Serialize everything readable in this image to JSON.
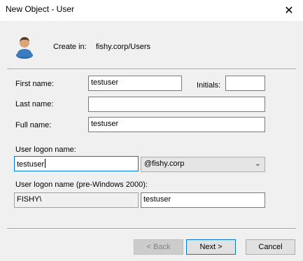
{
  "window": {
    "title": "New Object - User",
    "close_glyph": "✕"
  },
  "header": {
    "create_in_label": "Create in:",
    "create_in_value": "fishy.corp/Users",
    "icon": "user-icon"
  },
  "form": {
    "first_name_label": "First name:",
    "first_name_value": "testuser",
    "initials_label": "Initials:",
    "initials_value": "",
    "last_name_label": "Last name:",
    "last_name_value": "",
    "full_name_label": "Full name:",
    "full_name_value": "testuser",
    "logon_label": "User logon name:",
    "logon_value": "testuser",
    "domain_value": "@fishy.corp",
    "pre2000_label": "User logon name (pre-Windows 2000):",
    "pre2000_domain": "FISHY\\",
    "pre2000_value": "testuser"
  },
  "buttons": {
    "back": "< Back",
    "next": "Next >",
    "cancel": "Cancel"
  }
}
